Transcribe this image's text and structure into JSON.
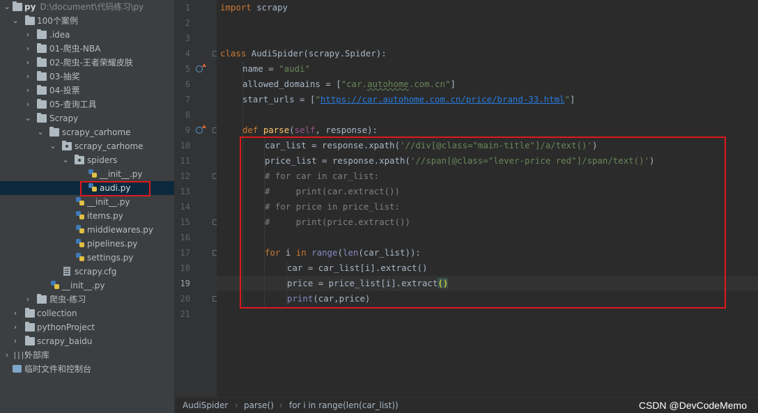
{
  "project_tree": {
    "root": {
      "name": "py",
      "path": "D:\\document\\代码练习\\py"
    },
    "items": [
      {
        "label": "100个案例"
      },
      {
        "label": ".idea"
      },
      {
        "label": "01-爬虫-NBA"
      },
      {
        "label": "02-爬虫-王者荣耀皮肤"
      },
      {
        "label": "03-抽奖"
      },
      {
        "label": "04-投票"
      },
      {
        "label": "05-查询工具"
      },
      {
        "label": "Scrapy"
      },
      {
        "label": "scrapy_carhome"
      },
      {
        "label": "scrapy_carhome"
      },
      {
        "label": "spiders"
      },
      {
        "label": "__init__.py"
      },
      {
        "label": "audi.py"
      },
      {
        "label": "__init__.py"
      },
      {
        "label": "items.py"
      },
      {
        "label": "middlewares.py"
      },
      {
        "label": "pipelines.py"
      },
      {
        "label": "settings.py"
      },
      {
        "label": "scrapy.cfg"
      },
      {
        "label": "__init__.py"
      },
      {
        "label": "爬虫-练习"
      },
      {
        "label": "collection"
      },
      {
        "label": "pythonProject"
      },
      {
        "label": "scrapy_baidu"
      },
      {
        "label": "外部库"
      },
      {
        "label": "临时文件和控制台"
      }
    ]
  },
  "editor": {
    "line_numbers": [
      "1",
      "2",
      "3",
      "4",
      "5",
      "6",
      "7",
      "8",
      "9",
      "10",
      "11",
      "12",
      "13",
      "14",
      "15",
      "16",
      "17",
      "18",
      "19",
      "20",
      "21"
    ],
    "current_line": "19",
    "tokens": {
      "l1_import": "import",
      "l1_mod": " scrapy",
      "l4_class": "class",
      "l4_name": " AudiSpider(scrapy.Spider):",
      "l5_lhs": "name = ",
      "l5_val": "\"audi\"",
      "l6_lhs": "allowed_domains = [",
      "l6_q1": "\"car.",
      "l6_sq": "autohome",
      "l6_q2": ".com.cn\"",
      "l6_end": "]",
      "l7_lhs": "start_urls = [",
      "l7_q1": "\"",
      "l7_url": "https://car.autohome.com.cn/price/brand-33.html",
      "l7_q2": "\"",
      "l7_end": "]",
      "l9_def": "def",
      "l9_fn": " parse",
      "l9_p1": "(",
      "l9_self": "self",
      "l9_p2": ", response):",
      "l10_lhs": "car_list = response.xpath(",
      "l10_str": "'//div[@class=\"main-title\"]/a/text()'",
      "l10_end": ")",
      "l11_lhs": "price_list = response.xpath(",
      "l11_str": "'//span[@class=\"lever-price red\"]/span/text()'",
      "l11_end": ")",
      "l12": "# for car in car_list:",
      "l13": "#     print(car.extract())",
      "l14": "# for price in price_list:",
      "l15": "#     print(price.extract())",
      "l17_for": "for",
      "l17_i": " i ",
      "l17_in": "in",
      "l17_sp": " ",
      "l17_range": "range",
      "l17_p": "(",
      "l17_len": "len",
      "l17_rest": "(car_list)):",
      "l18": "car = car_list[i].extract()",
      "l19_a": "price = price_list[i].extract",
      "l19_b": "()",
      "l20_print": "print",
      "l20_rest": "(car,price)"
    }
  },
  "breadcrumb": {
    "items": [
      "AudiSpider",
      "parse()",
      "for i in range(len(car_list))"
    ]
  },
  "watermark": "CSDN @DevCodeMemo",
  "colors": {
    "highlight_box": "#e0191c",
    "keyword": "#cc7832",
    "string": "#6a8759",
    "comment": "#808080",
    "function": "#ffc66d"
  }
}
